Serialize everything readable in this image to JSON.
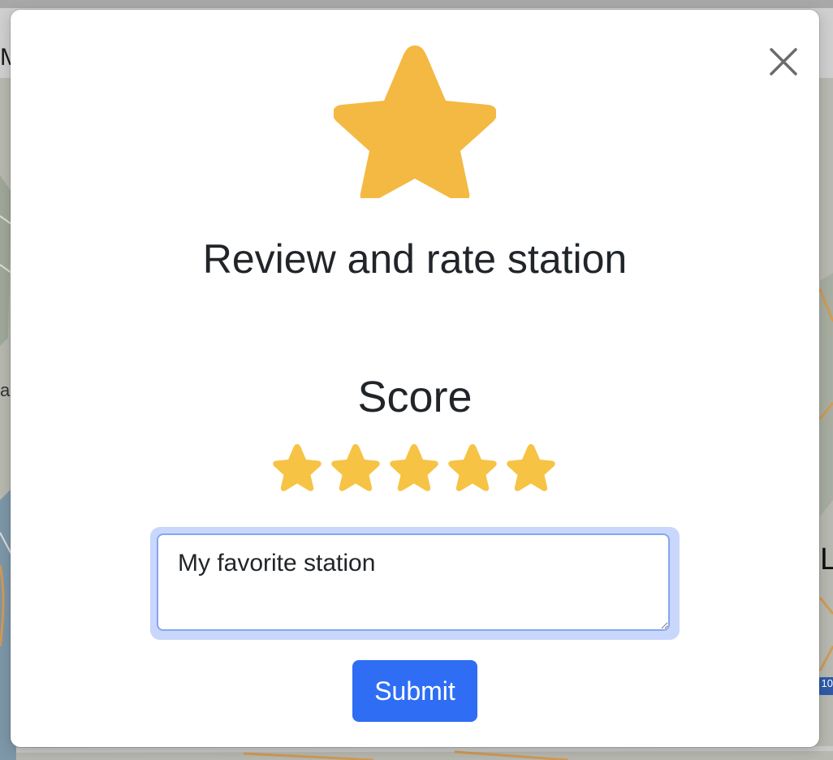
{
  "background": {
    "navbar_edge_text": "M",
    "map_label_left": "a",
    "map_label_right": "L",
    "highway_shield": "10"
  },
  "modal": {
    "close_icon": "close-icon",
    "hero_icon": "star-icon",
    "title": "Review and rate station",
    "score_label": "Score",
    "rating": {
      "value": 5,
      "max": 5,
      "star_color": "#f6c344"
    },
    "hero_star_color": "#f4b942",
    "comment": {
      "value": "My favorite station"
    },
    "submit_label": "Submit",
    "accent_color": "#2f6ef4"
  }
}
